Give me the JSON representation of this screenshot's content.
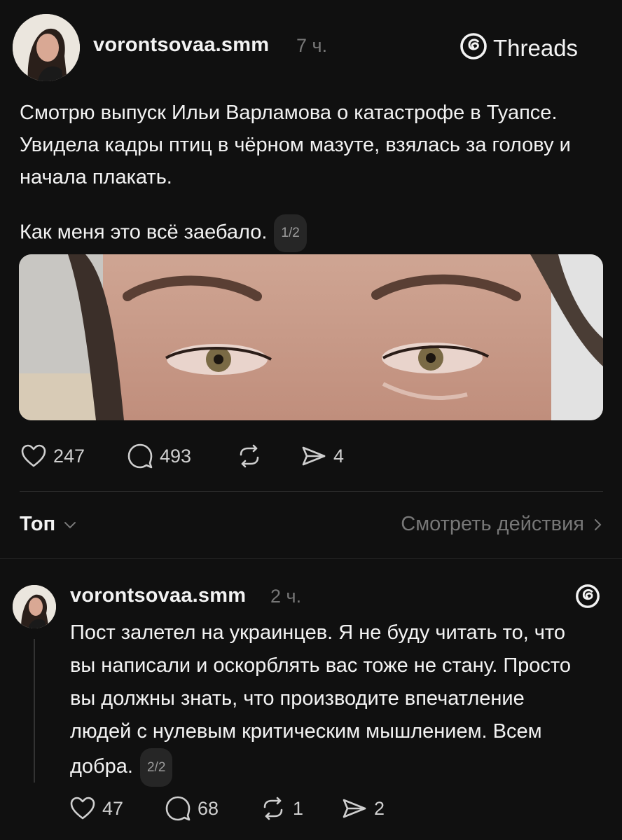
{
  "post": {
    "username": "vorontsovaa.smm",
    "time": "7 ч.",
    "brand": "Threads",
    "paragraph1": "Смотрю выпуск Ильи Варламова о катастрофе в Туапсе. Увидела кадры птиц в чёрном мазуте, взялась за голову и начала плакать.",
    "paragraph2": "Как меня это всё заебало.",
    "page_badge": "1/2",
    "likes": "247",
    "comments": "493",
    "shares": "4"
  },
  "sort": {
    "label": "Топ",
    "activity_link": "Смотреть действия"
  },
  "reply": {
    "username": "vorontsovaa.smm",
    "time": "2 ч.",
    "text": "Пост залетел на украинцев. Я не буду читать то, что вы написали и оскорблять вас тоже не стану. Просто вы должны знать, что производите впечатление людей с нулевым критическим мышлением. Всем добра.",
    "page_badge": "2/2",
    "likes": "47",
    "comments": "68",
    "reposts": "1",
    "shares": "2"
  },
  "colors": {
    "background": "#101010",
    "text": "#f3f3f3",
    "muted": "#777777"
  }
}
